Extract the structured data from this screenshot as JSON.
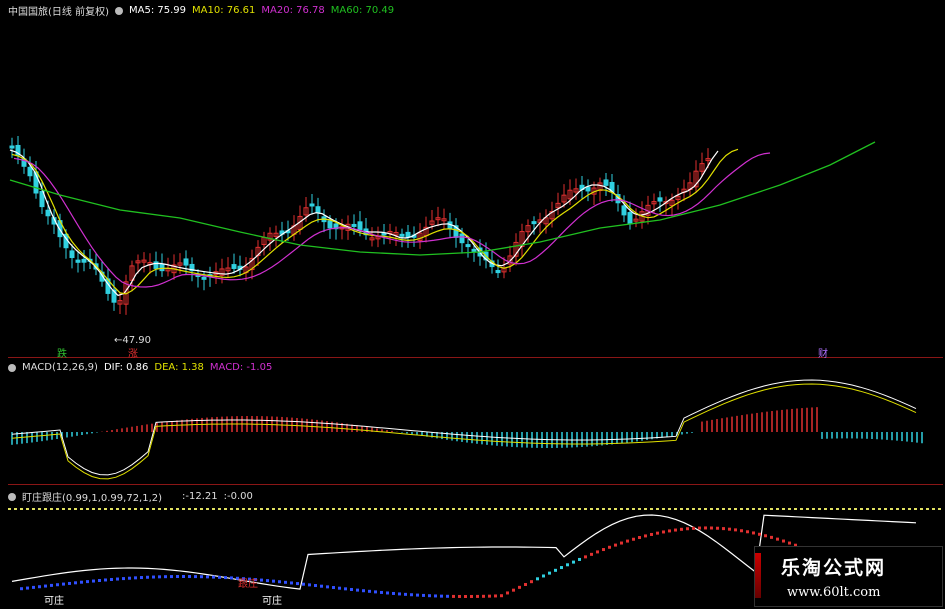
{
  "main_header": {
    "title": "中国国旅(日线 前复权)",
    "ma5": "MA5: 75.99",
    "ma10": "MA10: 76.61",
    "ma20": "MA20: 76.78",
    "ma60": "MA60: 70.49"
  },
  "low_label": "47.90",
  "markers": {
    "die": "跌",
    "zhang": "涨",
    "cai": "财"
  },
  "macd_header": {
    "title": "MACD(12,26,9)",
    "dif": "DIF: 0.86",
    "dea": "DEA: 1.38",
    "macd": "MACD: -1.05"
  },
  "dingzhuang_header": {
    "title": "盯庄跟庄(0.99,1,0.99,72,1,2)",
    "v1": ":-12.21",
    "v2": ":-0.00"
  },
  "bottom_labels": {
    "kezhuang1": "可庄",
    "kezhuang2": "可庄",
    "genzhuang": "跟庄"
  },
  "watermark": {
    "title": "乐淘公式网",
    "url": "www.60lt.com"
  },
  "colors": {
    "up": "#e03030",
    "down": "#30d0e0",
    "ma5": "#ffffff",
    "ma10": "#e0e000",
    "ma20": "#d030d0",
    "ma60": "#20c020",
    "grid": "#8a1616"
  }
}
